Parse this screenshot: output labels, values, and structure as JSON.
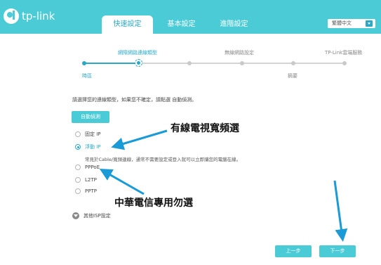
{
  "header": {
    "logo_text": "tp-link",
    "tabs": [
      {
        "label": "快速設定",
        "active": true
      },
      {
        "label": "基本設定",
        "active": false
      },
      {
        "label": "進階設定",
        "active": false
      }
    ],
    "language": "繁體中文",
    "accent_color": "#4acbd6"
  },
  "stepper": {
    "top_labels": [
      "網際網路連線類型",
      "無線網路設定",
      "TP-Link雲端服務"
    ],
    "bottom_labels": [
      "時區",
      "摘要"
    ]
  },
  "main": {
    "description": "請選擇您的連線類型，如果您不確定，請點選 自動偵測。",
    "autodetect_label": "自動偵測",
    "options": [
      {
        "label": "固定 IP",
        "checked": false
      },
      {
        "label": "浮動 IP",
        "checked": true
      },
      {
        "label": "PPPoE",
        "checked": false
      },
      {
        "label": "L2TP",
        "checked": false
      },
      {
        "label": "PPTP",
        "checked": false
      }
    ],
    "dynamic_ip_hint": "常見於Cable/寬頻連線，通常不需要設定或登入就可以立即讓您的電腦在線。",
    "isp_settings_label": "其他ISP設定"
  },
  "footer": {
    "back_label": "上一步",
    "next_label": "下一步"
  },
  "annotations": {
    "cable_tv": "有線電視寬頻選",
    "cht": "中華電信專用勿選",
    "arrow_color": "#1a9ad6"
  }
}
